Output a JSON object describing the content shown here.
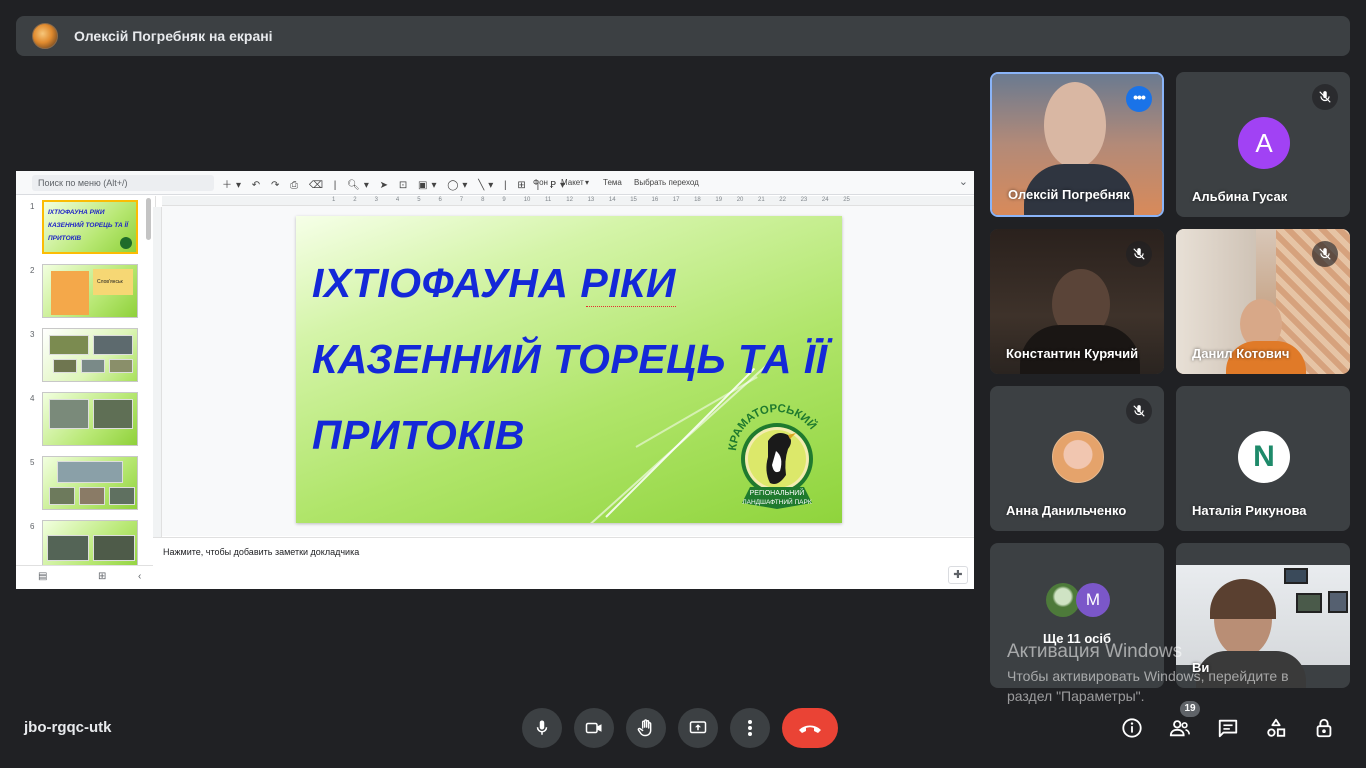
{
  "presenter_bar": {
    "text": "Олексій Погребняк на екрані"
  },
  "slides_editor": {
    "search_placeholder": "Поиск по меню (Alt+/)",
    "toolbar": {
      "background": "Фон",
      "layout": "Макет",
      "theme": "Тема",
      "transition": "Выбрать переход"
    },
    "thumbnails": [
      {
        "number": "1",
        "title_lines": [
          "ІХТІОФАУНА РІКИ",
          "КАЗЕННИЙ ТОРЕЦЬ ТА ЇЇ",
          "ПРИТОКІВ"
        ]
      },
      {
        "number": "2",
        "caption": "Слов'янськ"
      },
      {
        "number": "3"
      },
      {
        "number": "4"
      },
      {
        "number": "5"
      },
      {
        "number": "6"
      }
    ],
    "ruler_marks": [
      "1",
      "2",
      "3",
      "4",
      "5",
      "6",
      "7",
      "8",
      "9",
      "10",
      "11",
      "12",
      "13",
      "14",
      "15",
      "16",
      "17",
      "18",
      "19",
      "20",
      "21",
      "22",
      "23",
      "24",
      "25"
    ],
    "slide": {
      "title_line1": "ІХТІОФАУНА РІКИ",
      "title_line2": "КАЗЕННИЙ ТОРЕЦЬ ТА ЇЇ",
      "title_line3": "ПРИТОКІВ",
      "logo_top": "КРАМАТОРСЬКИЙ",
      "logo_bottom1": "РЕГІОНАЛЬНИЙ",
      "logo_bottom2": "ЛАНДШАФТНИЙ ПАРК"
    },
    "notes_placeholder": "Нажмите, чтобы добавить заметки докладчика"
  },
  "participants": [
    {
      "name": "Олексій Погребняк",
      "type": "video",
      "muted": false
    },
    {
      "name": "Альбина Гусак",
      "type": "avatar",
      "initial": "А",
      "color": "#a142f4",
      "muted": true
    },
    {
      "name": "Константин Курячий",
      "type": "video",
      "muted": true
    },
    {
      "name": "Данил Котович",
      "type": "video",
      "muted": true
    },
    {
      "name": "Анна Данильченко",
      "type": "photo-avatar",
      "muted": true
    },
    {
      "name": "Наталія Рикунова",
      "type": "logo-avatar",
      "initial": "N",
      "muted": false
    },
    {
      "name": "Ще 11 осіб",
      "type": "group",
      "initial": "M",
      "color": "#7b57c9"
    },
    {
      "name": "Ви",
      "type": "video",
      "muted": false
    }
  ],
  "windows_activation": {
    "title": "Активация Windows",
    "line1": "Чтобы активировать Windows, перейдите в",
    "line2": "раздел \"Параметры\"."
  },
  "bottom_bar": {
    "meeting_code": "jbo-rgqc-utk",
    "people_count": "19",
    "end_call_color": "#ea4335"
  }
}
